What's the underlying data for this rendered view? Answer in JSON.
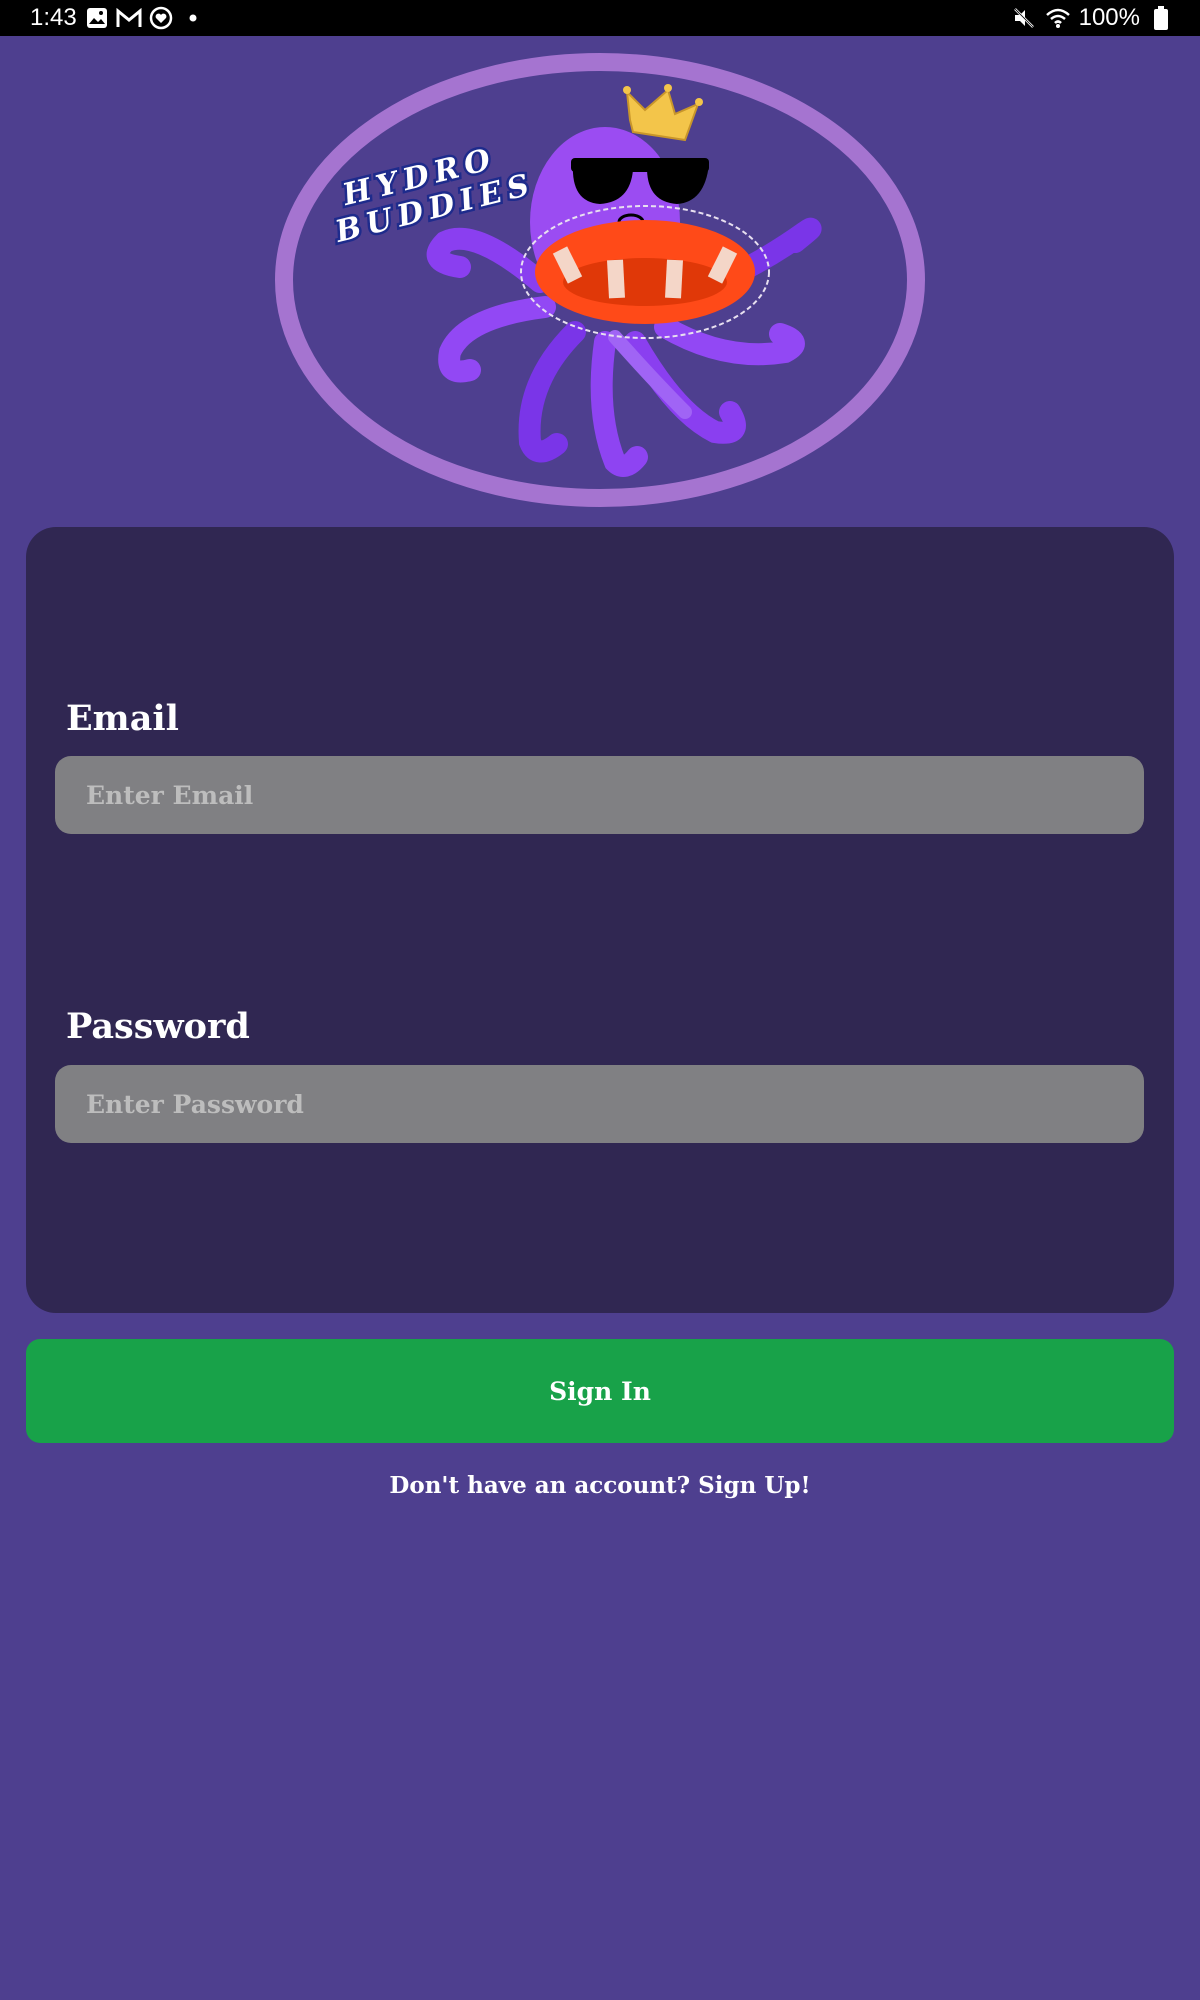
{
  "status_bar": {
    "time": "1:43",
    "battery": "100%",
    "left_icons": [
      "image-icon",
      "gmail-icon",
      "heart-badge-icon",
      "dot-icon"
    ],
    "right_icons": [
      "mute-icon",
      "wifi-icon",
      "battery-icon"
    ]
  },
  "logo": {
    "line1": "HYDRO",
    "line2": "BUDDIES"
  },
  "form": {
    "email_label": "Email",
    "email_placeholder": "Enter Email",
    "password_label": "Password",
    "password_placeholder": "Enter Password"
  },
  "actions": {
    "sign_in_label": "Sign In",
    "sign_up_text": "Don't have an account? Sign Up!"
  },
  "colors": {
    "background": "#4e3f8f",
    "card": "#302752",
    "input": "#808083",
    "button": "#18a249"
  }
}
